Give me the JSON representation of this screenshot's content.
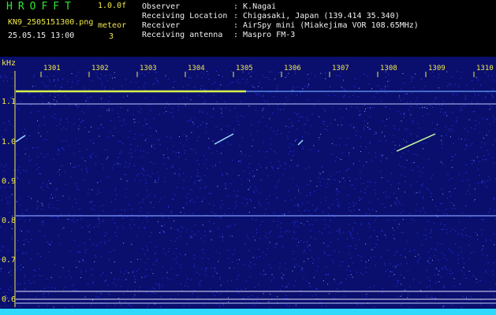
{
  "header": {
    "brand": "HROFFT",
    "version": "1.0.0f",
    "filename": "KN9_2505151300.png",
    "mode": "meteor",
    "datetime": "25.05.15 13:00",
    "count": "3",
    "info_lines": [
      {
        "label": "Observer",
        "value": ": K.Nagai"
      },
      {
        "label": "Receiving Location",
        "value": ": Chigasaki, Japan (139.414 35.340)"
      },
      {
        "label": "Receiver",
        "value": ": AirSpy mini (Miakejima VOR 108.65MHz)"
      },
      {
        "label": "Receiving antenna",
        "value": ": Maspro FM-3"
      }
    ]
  },
  "spectrogram": {
    "y_unit": "kHz",
    "y_ticks": [
      "1.1",
      "1.0",
      "0.9",
      "0.8",
      "0.7",
      "0.6"
    ],
    "x_ticks": [
      "1301",
      "1302",
      "1303",
      "1304",
      "1305",
      "1306",
      "1307",
      "1308",
      "1309",
      "1310"
    ],
    "colors": {
      "background": "#0a0f6e",
      "tick_label": "#f0e84a",
      "noise": "#2a3cff"
    }
  }
}
